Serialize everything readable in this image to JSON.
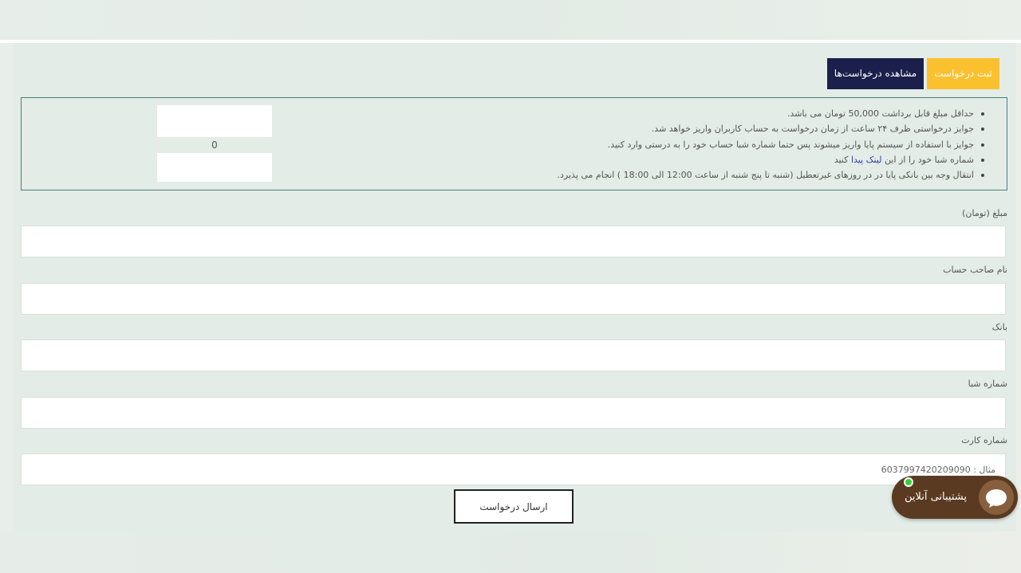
{
  "tabs": {
    "register": "ثبت درخواست",
    "view": "مشاهده درخواست‌ها"
  },
  "rules": [
    "حداقل مبلغ قابل برداشت 50,000 تومان می باشد.",
    "جوایز درخواستی ظرف ۲۴ ساعت از زمان درخواست به حساب کاربران واریز خواهد شد.",
    "جوایز با استفاده از سیستم پایا واریز میشوند پس حتما شماره شبا حساب خود را به درستی وارد کنید.",
    {
      "before": "شماره شبا خود را از این",
      "link": "لینک پیدا",
      "after": "کنید"
    },
    "انتقال وجه بین بانکی پایا در در روزهای غیرتعطیل (شنبه تا پنج شنبه از ساعت 12:00 الی 18:00 ) انجام می پذیرد."
  ],
  "balance": "0",
  "form": {
    "amount_label": "مبلغ (تومان)",
    "holder_label": "نام صاحب حساب",
    "bank_label": "بانک",
    "sheba_label": "شماره شبا",
    "card_label": "شماره کارت",
    "card_placeholder": "مثال : 6037997420209090",
    "submit": "ارسال درخواست"
  },
  "chat": {
    "label": "پشتیبانی آنلاین"
  },
  "colors": {
    "register_tab": "#fbc02d",
    "view_tab": "#1b1f4b",
    "chat_bg": "#5a3a21",
    "online_dot": "#31d13b"
  },
  "icons": [
    "chat-bubble-icon",
    "online-status-icon"
  ]
}
